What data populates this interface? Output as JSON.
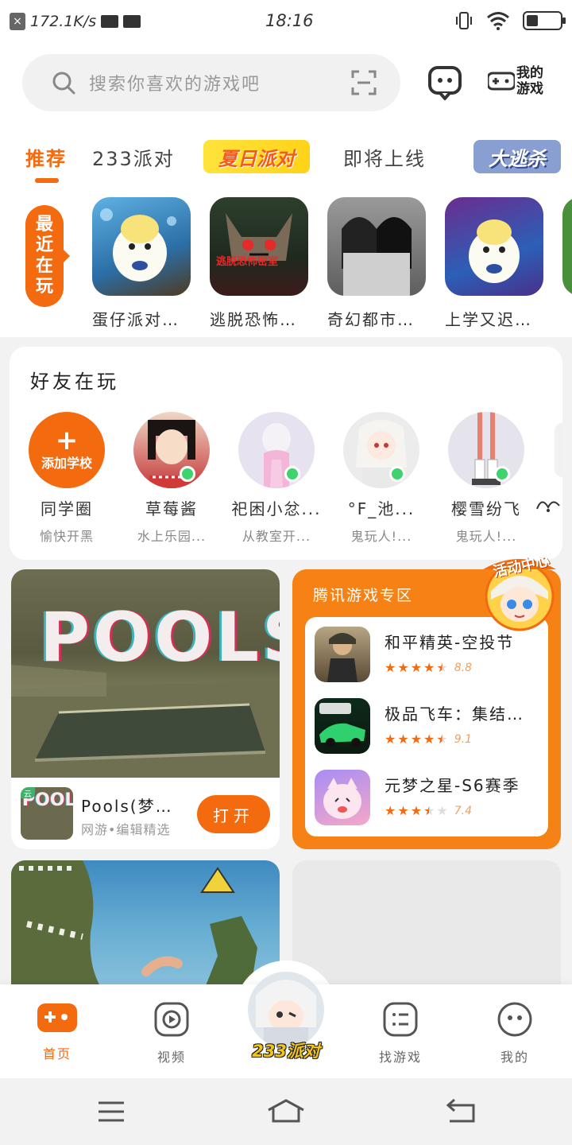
{
  "status_bar": {
    "speed": "172.1K/s",
    "time": "18:16"
  },
  "search": {
    "placeholder": "搜索你喜欢的游戏吧"
  },
  "header": {
    "my_games_line1": "我的",
    "my_games_line2": "游戏"
  },
  "tabs": [
    {
      "label": "推荐"
    },
    {
      "label": "233派对"
    },
    {
      "label": "夏日派对"
    },
    {
      "label": "即将上线"
    },
    {
      "label": "大逃杀"
    }
  ],
  "recent": {
    "tag": [
      "最",
      "近",
      "在",
      "玩"
    ],
    "games": [
      {
        "name": "蛋仔派对…"
      },
      {
        "name": "逃脱恐怖…"
      },
      {
        "name": "奇幻都市…"
      },
      {
        "name": "上学又迟…"
      }
    ],
    "thumb_text": "逃脱恐怖密室"
  },
  "friends": {
    "title": "好友在玩",
    "add_school": "添加学校",
    "list": [
      {
        "name": "同学圈",
        "status": "愉快开黑"
      },
      {
        "name": "草莓酱",
        "status": "水上乐园..."
      },
      {
        "name": "祀困小忿...",
        "status": "从教室开..."
      },
      {
        "name": "°F_池...",
        "status": "鬼玩人!..."
      },
      {
        "name": "樱雪纷飞",
        "status": "鬼玩人!..."
      }
    ]
  },
  "pools_card": {
    "image_text": "POOLS",
    "icon_text": "POOLS",
    "cloud_badge": "云",
    "name": "Pools(梦…",
    "subtitle": "网游•编辑精选",
    "open_label": "打开"
  },
  "tencent_card": {
    "title": "腾讯游戏专区",
    "activity_label": "活动中心",
    "games": [
      {
        "name": "和平精英-空投节",
        "rating": "8.8",
        "stars": 4.5
      },
      {
        "name": "极品飞车：集结…",
        "rating": "9.1",
        "stars": 4.5
      },
      {
        "name": "元梦之星-S6赛季",
        "rating": "7.4",
        "stars": 3.5
      }
    ]
  },
  "bottom_nav": [
    {
      "label": "首页"
    },
    {
      "label": "视频"
    },
    {
      "label": "233派对"
    },
    {
      "label": "找游戏"
    },
    {
      "label": "我的"
    }
  ],
  "colors": {
    "accent": "#f46a0f",
    "tencent_bg": "#f68216",
    "online": "#3ed36b"
  }
}
